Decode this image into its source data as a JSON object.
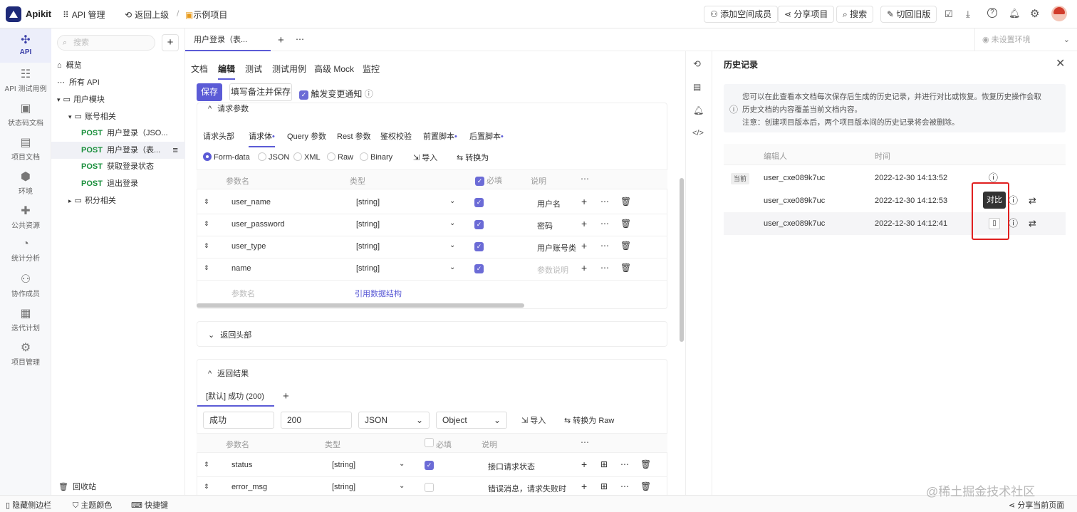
{
  "app": {
    "name": "Apikit",
    "accent": "#5b5bd6",
    "post_color": "#1a8f3c",
    "highlight_color": "#e02020"
  },
  "topbar": {
    "api_manage": "API 管理",
    "back": "返回上级",
    "separator": "/",
    "project": "示例项目",
    "add_member": "添加空间成员",
    "share": "分享项目",
    "search": "搜索",
    "switch_old": "切回旧版"
  },
  "leftnav": [
    {
      "label": "API",
      "icon": "api-icon"
    },
    {
      "label": "API 测试用例",
      "icon": "test-case-icon"
    },
    {
      "label": "状态码文档",
      "icon": "status-code-icon"
    },
    {
      "label": "项目文档",
      "icon": "doc-icon"
    },
    {
      "label": "环境",
      "icon": "environment-icon"
    },
    {
      "label": "公共资源",
      "icon": "puzzle-icon"
    },
    {
      "label": "统计分析",
      "icon": "chart-icon"
    },
    {
      "label": "协作成员",
      "icon": "members-icon"
    },
    {
      "label": "迭代计划",
      "icon": "calendar-icon"
    },
    {
      "label": "项目管理",
      "icon": "gear-icon"
    }
  ],
  "tree": {
    "search_placeholder": "搜索",
    "overview": "概览",
    "all_api": "所有 API",
    "user_module": "用户模块",
    "account": "账号相关",
    "items": [
      {
        "method": "POST",
        "name": "用户登录（JSO..."
      },
      {
        "method": "POST",
        "name": "用户登录（表..."
      },
      {
        "method": "POST",
        "name": "获取登录状态"
      },
      {
        "method": "POST",
        "name": "退出登录"
      }
    ],
    "points": "积分相关",
    "recycle": "回收站"
  },
  "doctab": {
    "title": "用户登录（表..."
  },
  "env": {
    "label": "未设置环境"
  },
  "subtabs": [
    "文档",
    "编辑",
    "测试",
    "测试用例",
    "高级 Mock",
    "监控"
  ],
  "actions": {
    "save": "保存",
    "save_note": "填写备注并保存",
    "notify": "触发变更通知"
  },
  "request": {
    "title": "请求参数",
    "tabs": [
      "请求头部",
      "请求体",
      "Query 参数",
      "Rest 参数",
      "鉴权校验",
      "前置脚本",
      "后置脚本"
    ],
    "body_types": [
      "Form-data",
      "JSON",
      "XML",
      "Raw",
      "Binary"
    ],
    "import": "导入",
    "convert": "转换为",
    "columns": {
      "name": "参数名",
      "type": "类型",
      "required": "必填",
      "desc": "说明"
    },
    "rows": [
      {
        "name": "user_name",
        "type": "[string]",
        "desc": "用户名"
      },
      {
        "name": "user_password",
        "type": "[string]",
        "desc": "密码"
      },
      {
        "name": "user_type",
        "type": "[string]",
        "desc": "用户账号类"
      },
      {
        "name": "name",
        "type": "[string]",
        "desc": "参数说明"
      }
    ],
    "placeholder_name": "参数名",
    "ref_struct": "引用数据结构"
  },
  "response_header": {
    "title": "返回头部"
  },
  "response_result": {
    "title": "返回结果",
    "tab": "[默认] 成功 (200)",
    "name": "成功",
    "code": "200",
    "format": "JSON",
    "root": "Object",
    "import": "导入",
    "convert": "转换为 Raw",
    "columns": {
      "name": "参数名",
      "type": "类型",
      "required": "必填",
      "desc": "说明"
    },
    "rows": [
      {
        "name": "status",
        "type": "[string]",
        "desc": "接口请求状态"
      },
      {
        "name": "error_msg",
        "type": "[string]",
        "desc": "错误消息，请求失败时"
      }
    ]
  },
  "history": {
    "title": "历史记录",
    "notice_line1": "您可以在此查看本文档每次保存后生成的历史记录，并进行对比或恢复。恢复历史操作会取",
    "notice_line2": "历史文档的内容覆盖当前文档内容。",
    "notice_line3": "注意：创建项目版本后，两个项目版本间的历史记录将会被删除。",
    "col_editor": "编辑人",
    "col_time": "时间",
    "current": "当前",
    "tooltip": "对比",
    "rows": [
      {
        "editor": "user_cxe089k7uc",
        "time": "2022-12-30 14:13:52"
      },
      {
        "editor": "user_cxe089k7uc",
        "time": "2022-12-30 14:12:53"
      },
      {
        "editor": "user_cxe089k7uc",
        "time": "2022-12-30 14:12:41"
      }
    ]
  },
  "bottombar": {
    "hide_sidebar": "隐藏侧边栏",
    "theme": "主题颜色",
    "shortcut": "快捷键",
    "share_page": "分享当前页面",
    "watermark": "@稀土掘金技术社区"
  }
}
